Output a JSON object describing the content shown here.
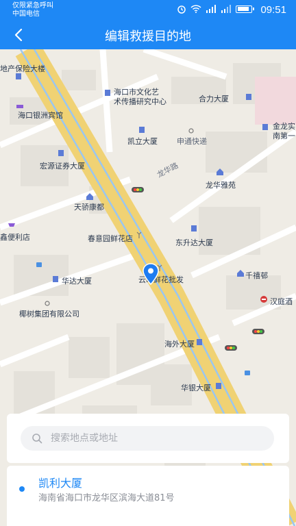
{
  "status_bar": {
    "carrier_line1": "仅限紧急呼叫",
    "carrier_line2": "中国电信",
    "time": "09:51"
  },
  "nav": {
    "title": "编辑救援目的地"
  },
  "map": {
    "labels": [
      "地产保险大楼",
      "海口市文化艺",
      "术传播研究中心",
      "合力大厦",
      "海口银洲宾馆",
      "金龙实",
      "南第一",
      "凯立大厦",
      "申通快递",
      "宏源证券大厦",
      "龙华路",
      "龙华雅苑",
      "天骄康都",
      "春意园鲜花店",
      "东升达大厦",
      "鑫便利店",
      "千禧邨",
      "华达大厦",
      "云峰鲜花批发",
      "汉庭酒",
      "椰树集团有限公司",
      "海外大厦",
      "华银大厦"
    ]
  },
  "search": {
    "placeholder": "搜索地点或地址"
  },
  "result": {
    "name": "凯利大厦",
    "address": "海南省海口市龙华区滨海大道81号"
  }
}
